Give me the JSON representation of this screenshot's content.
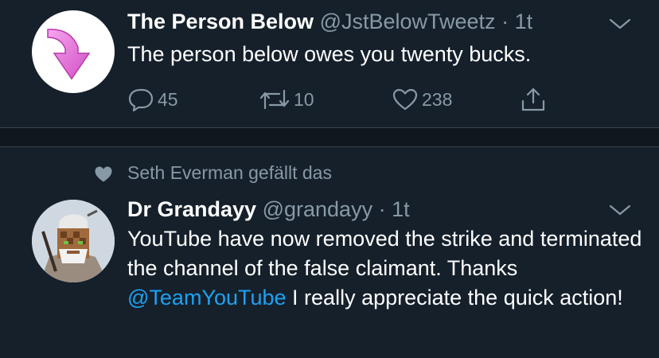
{
  "tweet1": {
    "display_name": "The Person Below",
    "handle": "@JstBelowTweetz",
    "separator": "·",
    "time": "1t",
    "text": "The person below owes you twenty bucks.",
    "actions": {
      "replies": "45",
      "retweets": "10",
      "likes": "238"
    }
  },
  "tweet2": {
    "social_context": "Seth Everman gefällt das",
    "display_name": "Dr Grandayy",
    "handle": "@grandayy",
    "separator": "·",
    "time": "1t",
    "text_part1": "YouTube have now removed the strike and terminated the channel of the false claimant. Thanks ",
    "mention": "@TeamYouTube",
    "text_part2": " I really appreciate the quick action!"
  },
  "colors": {
    "background": "#15202b",
    "secondary_text": "#8899a6",
    "link": "#1da1f2",
    "divider": "#38444d",
    "arrow_pink": "#e87ad8"
  },
  "icons": [
    "down-arrow-avatar",
    "chevron-down-icon",
    "reply-icon",
    "retweet-icon",
    "heart-icon",
    "share-icon",
    "liked-heart-icon",
    "knight-avatar"
  ]
}
